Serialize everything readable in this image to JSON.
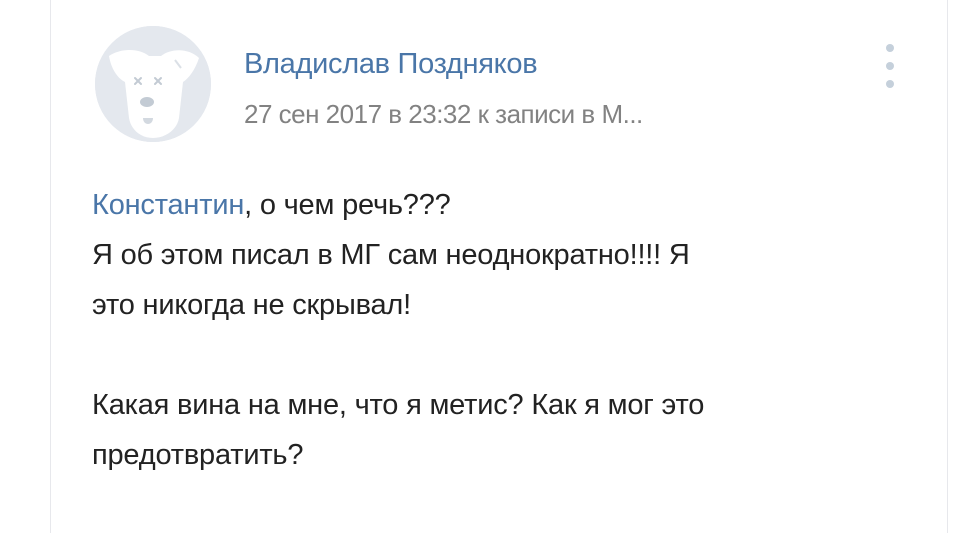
{
  "comment": {
    "author": "Владислав Поздняков",
    "meta": "27 сен 2017 в 23:32 к записи в М...",
    "reply_to": "Константин",
    "first_line_rest": ", о чем речь???",
    "line2": "Я об этом писал в МГ сам неоднократно!!!! Я",
    "line3": "это никогда не скрывал!",
    "line4": "Какая вина на мне, что я метис? Как я мог это",
    "line5": "предотвратить?"
  },
  "icons": {
    "avatar": "deactivated-dog-avatar",
    "more": "more-vertical-icon"
  },
  "colors": {
    "link": "#4a76a8",
    "text": "#222222",
    "muted": "#828282",
    "avatar_bg": "#e4e8ee"
  }
}
